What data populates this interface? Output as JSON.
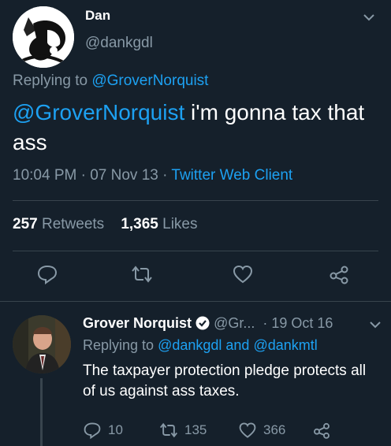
{
  "tweet": {
    "author_name": "Dan",
    "author_handle": "@dankgdl",
    "replying_prefix": "Replying to ",
    "replying_to": "@GroverNorquist",
    "mention": "@GroverNorquist",
    "text": " i'm gonna tax that ass",
    "time": "10:04 PM",
    "date": "07 Nov 13",
    "source": "Twitter Web Client",
    "retweets_count": "257",
    "retweets_label": "Retweets",
    "likes_count": "1,365",
    "likes_label": "Likes"
  },
  "reply": {
    "author_name": "Grover Norquist",
    "author_handle": "@Gr...",
    "date": "19 Oct 16",
    "replying_prefix": "Replying to ",
    "replying_to_1": "@dankgdl",
    "replying_and": " and ",
    "replying_to_2": "@dankmtl",
    "text": "The taxpayer protection pledge protects all of us against ass taxes.",
    "replies_count": "10",
    "retweets_count": "135",
    "likes_count": "366"
  },
  "icons": {
    "verified": "verified-badge-icon",
    "reply": "reply-icon",
    "retweet": "retweet-icon",
    "like": "heart-icon",
    "share": "share-icon",
    "more": "chevron-down-icon"
  },
  "colors": {
    "background": "#15202b",
    "accent": "#1da1f2",
    "muted": "#8899a6",
    "divider": "#38444d"
  }
}
